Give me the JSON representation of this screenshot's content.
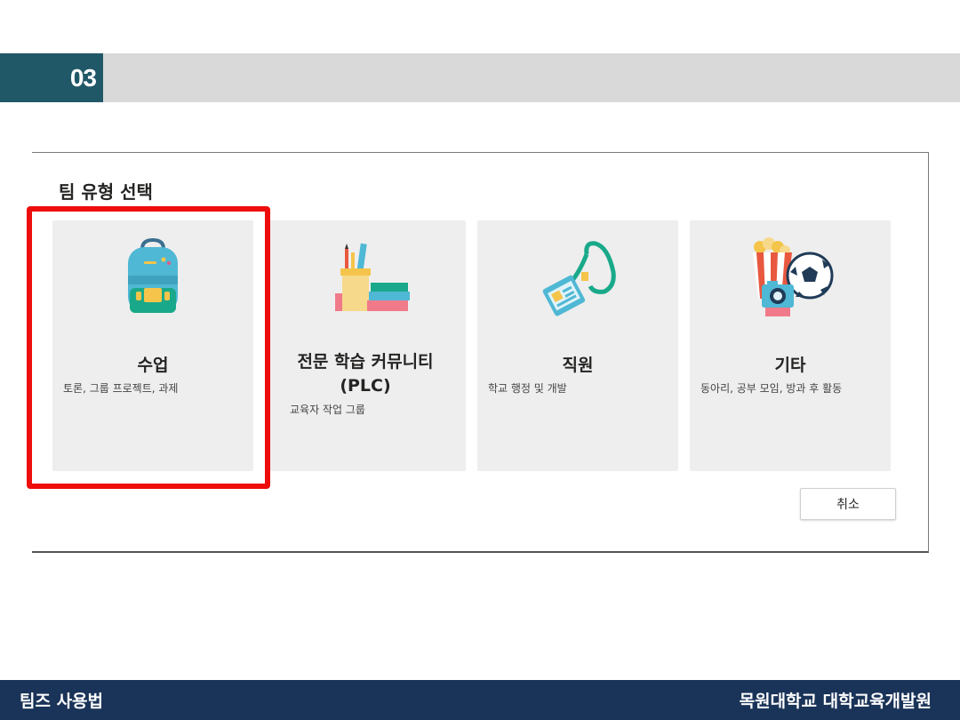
{
  "section": {
    "number": "03"
  },
  "dialog": {
    "title": "팀 유형 선택",
    "cards": [
      {
        "title": "수업",
        "description": "토론, 그룹 프로젝트, 과제",
        "icon": "backpack-icon"
      },
      {
        "title_line1": "전문 학습 커뮤니티",
        "title_line2": "(PLC)",
        "description": "교육자 작업 그룹",
        "icon": "pencil-cup-books-icon"
      },
      {
        "title": "직원",
        "description": "학교 행정 및 개발",
        "icon": "id-badge-lanyard-icon"
      },
      {
        "title": "기타",
        "description": "동아리, 공부 모임, 방과 후 활동",
        "icon": "popcorn-camera-ball-icon"
      }
    ],
    "cancel_label": "취소"
  },
  "footer": {
    "left": "팀즈 사용법",
    "right": "목원대학교 대학교육개발원"
  },
  "colors": {
    "section_accent": "#215867",
    "highlight": "#ee0d0d",
    "footer_bg": "#1a3358"
  }
}
